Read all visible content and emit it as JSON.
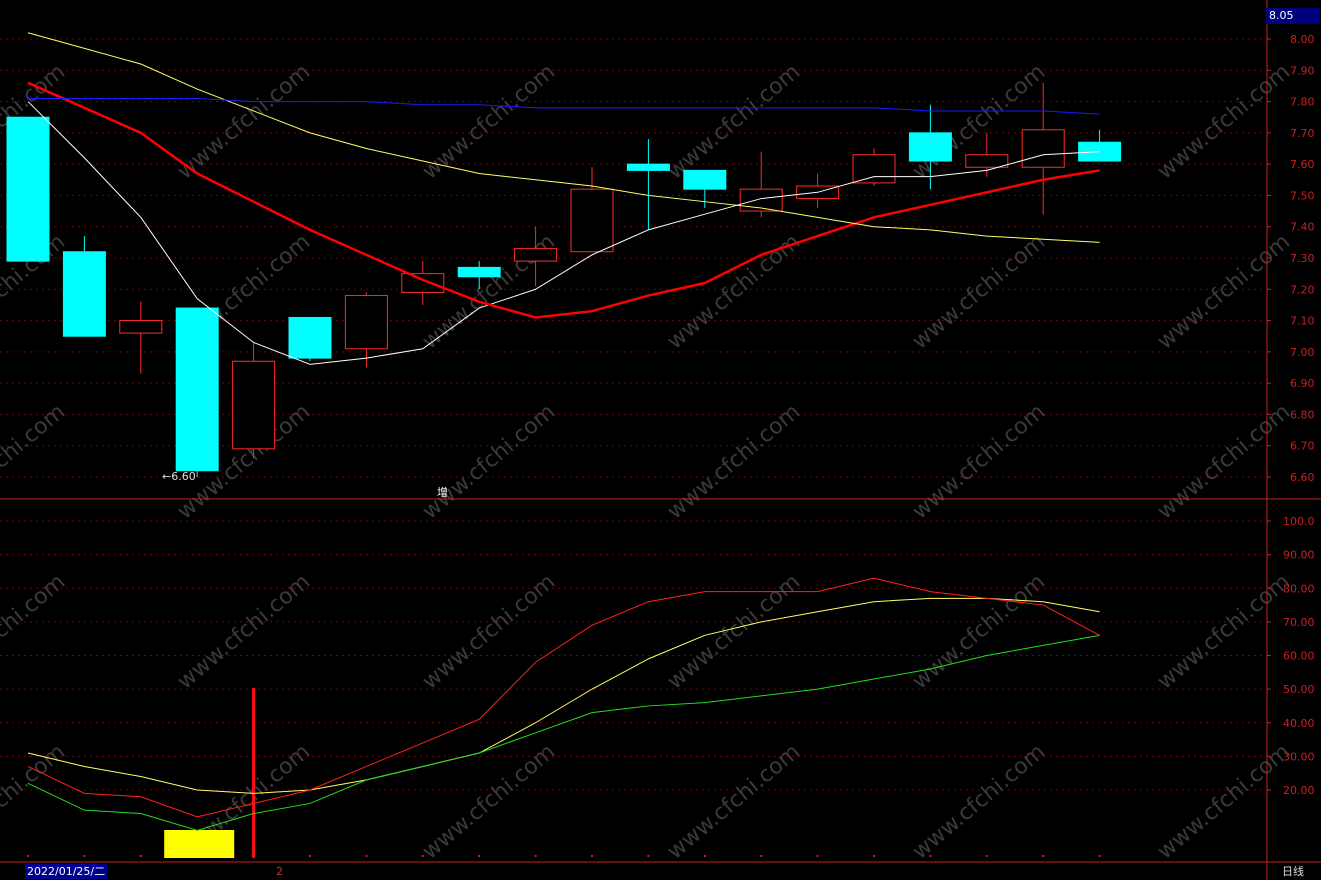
{
  "header": {
    "current_price_tag": "8.05"
  },
  "footer": {
    "date": "2022/01/25/二",
    "page": "2",
    "period": "日线"
  },
  "indicator": {
    "label": "增"
  },
  "annotations": {
    "low_marker": "←6.60"
  },
  "watermark": "www.cfchi.com",
  "colors": {
    "up": "#ff2a2a",
    "down": "#00ffff",
    "ma5": "#ffffff",
    "ma10": "#ff0000",
    "ma20": "#ffff66",
    "ma60": "#1a1aff",
    "k": "#ffff66",
    "d": "#ff2020",
    "j": "#22dd22",
    "grid": "#7a0000",
    "axis": "#c82020",
    "signal_bar": "#ffff00"
  },
  "chart_data": [
    {
      "type": "candlestick",
      "title": "",
      "ylim": [
        6.55,
        8.05
      ],
      "yticks": [
        "8.00",
        "7.90",
        "7.80",
        "7.70",
        "7.60",
        "7.50",
        "7.40",
        "7.30",
        "7.20",
        "7.10",
        "7.00",
        "6.90",
        "6.80",
        "6.70",
        "6.60"
      ],
      "candles": [
        {
          "o": 7.75,
          "h": 7.75,
          "l": 7.29,
          "c": 7.29
        },
        {
          "o": 7.32,
          "h": 7.37,
          "l": 7.05,
          "c": 7.05
        },
        {
          "o": 7.06,
          "h": 7.16,
          "l": 6.93,
          "c": 7.1
        },
        {
          "o": 7.14,
          "h": 7.14,
          "l": 6.6,
          "c": 6.62
        },
        {
          "o": 6.69,
          "h": 7.03,
          "l": 6.66,
          "c": 6.97
        },
        {
          "o": 7.11,
          "h": 7.11,
          "l": 6.97,
          "c": 6.98
        },
        {
          "o": 7.01,
          "h": 7.19,
          "l": 6.95,
          "c": 7.18
        },
        {
          "o": 7.19,
          "h": 7.29,
          "l": 7.15,
          "c": 7.25
        },
        {
          "o": 7.27,
          "h": 7.29,
          "l": 7.2,
          "c": 7.24
        },
        {
          "o": 7.29,
          "h": 7.4,
          "l": 7.21,
          "c": 7.33
        },
        {
          "o": 7.32,
          "h": 7.59,
          "l": 7.32,
          "c": 7.52
        },
        {
          "o": 7.6,
          "h": 7.68,
          "l": 7.39,
          "c": 7.58
        },
        {
          "o": 7.58,
          "h": 7.58,
          "l": 7.46,
          "c": 7.52
        },
        {
          "o": 7.45,
          "h": 7.64,
          "l": 7.43,
          "c": 7.52
        },
        {
          "o": 7.49,
          "h": 7.57,
          "l": 7.46,
          "c": 7.53
        },
        {
          "o": 7.54,
          "h": 7.65,
          "l": 7.53,
          "c": 7.63
        },
        {
          "o": 7.7,
          "h": 7.79,
          "l": 7.52,
          "c": 7.61
        },
        {
          "o": 7.59,
          "h": 7.7,
          "l": 7.56,
          "c": 7.63
        },
        {
          "o": 7.59,
          "h": 7.86,
          "l": 7.44,
          "c": 7.71
        },
        {
          "o": 7.67,
          "h": 7.71,
          "l": 7.62,
          "c": 7.61
        }
      ],
      "series": [
        {
          "key": "ma5",
          "values": [
            7.8,
            7.62,
            7.43,
            7.17,
            7.03,
            6.96,
            6.98,
            7.01,
            7.14,
            7.2,
            7.31,
            7.39,
            7.44,
            7.49,
            7.51,
            7.56,
            7.56,
            7.58,
            7.63,
            7.64
          ]
        },
        {
          "key": "ma10",
          "values": [
            7.86,
            7.78,
            7.7,
            7.57,
            7.48,
            7.39,
            7.31,
            7.23,
            7.16,
            7.11,
            7.13,
            7.18,
            7.22,
            7.31,
            7.37,
            7.43,
            7.47,
            7.51,
            7.55,
            7.58
          ]
        },
        {
          "key": "ma20",
          "values": [
            8.02,
            7.97,
            7.92,
            7.84,
            7.77,
            7.7,
            7.65,
            7.61,
            7.57,
            7.55,
            7.53,
            7.5,
            7.48,
            7.46,
            7.43,
            7.4,
            7.39,
            7.37,
            7.36,
            7.35
          ]
        },
        {
          "key": "ma60",
          "values": [
            7.81,
            7.81,
            7.81,
            7.81,
            7.8,
            7.8,
            7.8,
            7.79,
            7.79,
            7.78,
            7.78,
            7.78,
            7.78,
            7.78,
            7.78,
            7.78,
            7.77,
            7.77,
            7.77,
            7.76
          ]
        }
      ]
    },
    {
      "type": "line",
      "title": "",
      "ylim": [
        0,
        104
      ],
      "yticks": [
        "100.0",
        "90.00",
        "80.00",
        "70.00",
        "60.00",
        "50.00",
        "40.00",
        "30.00",
        "20.00"
      ],
      "series": [
        {
          "key": "k",
          "values": [
            31,
            27,
            24,
            20,
            19,
            20,
            23,
            27,
            31,
            40,
            50,
            59,
            66,
            70,
            73,
            76,
            77,
            77,
            76,
            73
          ]
        },
        {
          "key": "d",
          "values": [
            27,
            19,
            18,
            12,
            16,
            20,
            27,
            34,
            41,
            58,
            69,
            76,
            79,
            79,
            79,
            83,
            79,
            77,
            75,
            66
          ]
        },
        {
          "key": "j",
          "values": [
            22,
            14,
            13,
            8,
            13,
            16,
            23,
            27,
            31,
            37,
            43,
            45,
            46,
            48,
            50,
            53,
            56,
            60,
            63,
            66
          ]
        }
      ],
      "signal_index": 4,
      "signal_block_index": 3
    }
  ]
}
